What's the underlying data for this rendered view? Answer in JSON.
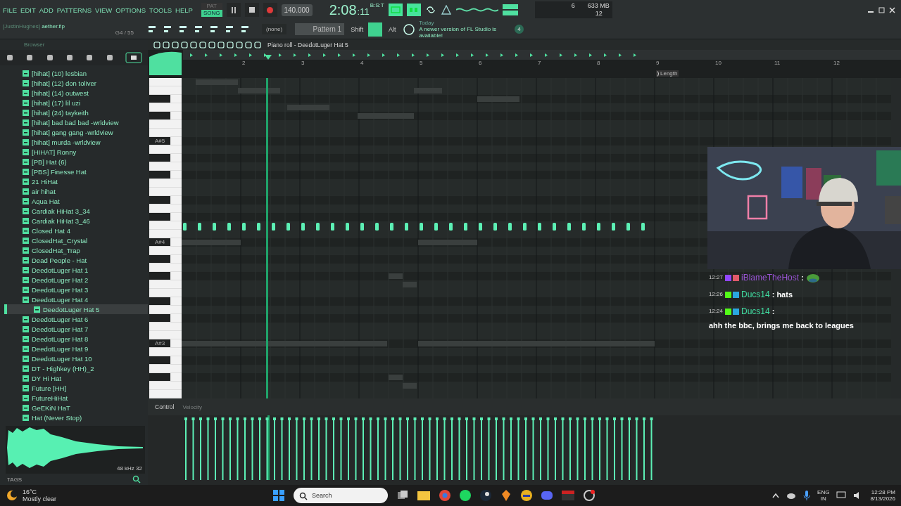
{
  "menu": [
    "FILE",
    "EDIT",
    "ADD",
    "PATTERNS",
    "VIEW",
    "OPTIONS",
    "TOOLS",
    "HELP"
  ],
  "transport": {
    "modes": [
      {
        "label": "PAT",
        "selected": false
      },
      {
        "label": "SONG",
        "selected": true
      }
    ],
    "tempo": "140.000",
    "time": "2:08",
    "time_ticks": ":11",
    "time_format": "B:S:T"
  },
  "monitor": {
    "cpu": "6",
    "memory": "633 MB",
    "polyphony": "12"
  },
  "project": {
    "owner": "[JustinHughes]",
    "file": "aether.flp",
    "position": "G4 / 55"
  },
  "toolbar": {
    "snap": "(none)",
    "pattern": "Pattern 1",
    "modifiers": [
      {
        "label": "Shift",
        "on": false
      },
      {
        "on": true
      },
      {
        "label": "Alt",
        "on": false
      }
    ]
  },
  "hint": {
    "date": "Today",
    "text": "A newer version of FL Studio is available!",
    "badge": "4"
  },
  "browser": {
    "title": "Browser",
    "items": [
      {
        "label": "[hihat] (10) lesbian",
        "selected": false
      },
      {
        "label": "[hihat] (12) don toliver",
        "selected": false
      },
      {
        "label": "[hihat] (14) outwest",
        "selected": false
      },
      {
        "label": "[hihat] (17) lil uzi",
        "selected": false
      },
      {
        "label": "[hihat] (24) taykeith",
        "selected": false
      },
      {
        "label": "[hihat] bad bad bad -wrldview",
        "selected": false
      },
      {
        "label": "[hihat] gang gang -wrldview",
        "selected": false
      },
      {
        "label": "[hihat] murda -wrldview",
        "selected": false
      },
      {
        "label": "[HIHAT] Ronny",
        "selected": false
      },
      {
        "label": "[PB] Hat (6)",
        "selected": false
      },
      {
        "label": "[PBS] Finesse Hat",
        "selected": false
      },
      {
        "label": "21 HiHat",
        "selected": false
      },
      {
        "label": "air hihat",
        "selected": false
      },
      {
        "label": "Aqua Hat",
        "selected": false
      },
      {
        "label": "Cardiak HiHat 3_34",
        "selected": false
      },
      {
        "label": "Cardiak HiHat 3_46",
        "selected": false
      },
      {
        "label": "Closed Hat 4",
        "selected": false
      },
      {
        "label": "ClosedHat_Crystal",
        "selected": false
      },
      {
        "label": "ClosedHat_Trap",
        "selected": false
      },
      {
        "label": "Dead People - Hat",
        "selected": false
      },
      {
        "label": "DeedotLuger Hat 1",
        "selected": false
      },
      {
        "label": "DeedotLuger Hat 2",
        "selected": false
      },
      {
        "label": "DeedotLuger Hat 3",
        "selected": false
      },
      {
        "label": "DeedotLuger Hat 4",
        "selected": false
      },
      {
        "label": "DeedotLuger Hat 5",
        "selected": true
      },
      {
        "label": "DeedotLuger Hat 6",
        "selected": false
      },
      {
        "label": "DeedotLuger Hat 7",
        "selected": false
      },
      {
        "label": "DeedotLuger Hat 8",
        "selected": false
      },
      {
        "label": "DeedotLuger Hat 9",
        "selected": false
      },
      {
        "label": "DeedotLuger Hat 10",
        "selected": false
      },
      {
        "label": "DT - Highkey (HH)_2",
        "selected": false
      },
      {
        "label": "DY Hi Hat",
        "selected": false
      },
      {
        "label": "Future [HH]",
        "selected": false
      },
      {
        "label": "FutureHiHat",
        "selected": false
      },
      {
        "label": "GeEKiN HaT",
        "selected": false
      },
      {
        "label": "Hat (Never Stop)",
        "selected": false
      }
    ],
    "sample_info": "48 kHz 32",
    "tags": "TAGS"
  },
  "piano_roll": {
    "title": "Piano roll - DeedotLuger Hat 5",
    "bars": [
      "2",
      "3",
      "4",
      "5",
      "6",
      "7",
      "8",
      "9",
      "10",
      "11",
      "12"
    ],
    "length": "Length",
    "key_labels": [
      "A#5",
      "A#4",
      "A#3"
    ],
    "control": "Control",
    "control_target": "Velocity"
  },
  "chat": [
    {
      "time": "12:27",
      "user": "iBlameTheHost",
      "color": "#9a55d6",
      "kind": "emote",
      "separator": ":"
    },
    {
      "time": "12:26",
      "user": "Ducs14",
      "color": "#3fdca0",
      "kind": "text",
      "separator": ":",
      "text": "hats"
    },
    {
      "time": "12:24",
      "user": "Ducs14",
      "color": "#3fdca0",
      "kind": "text",
      "separator": ":",
      "text": "ahh the bbc, brings me back to leagues"
    }
  ],
  "taskbar": {
    "temperature": "16°C",
    "weather": "Mostly clear",
    "search_placeholder": "Search",
    "language": "ENG",
    "region": "IN",
    "time": "12:28 PM",
    "date": "8/13/2026"
  }
}
